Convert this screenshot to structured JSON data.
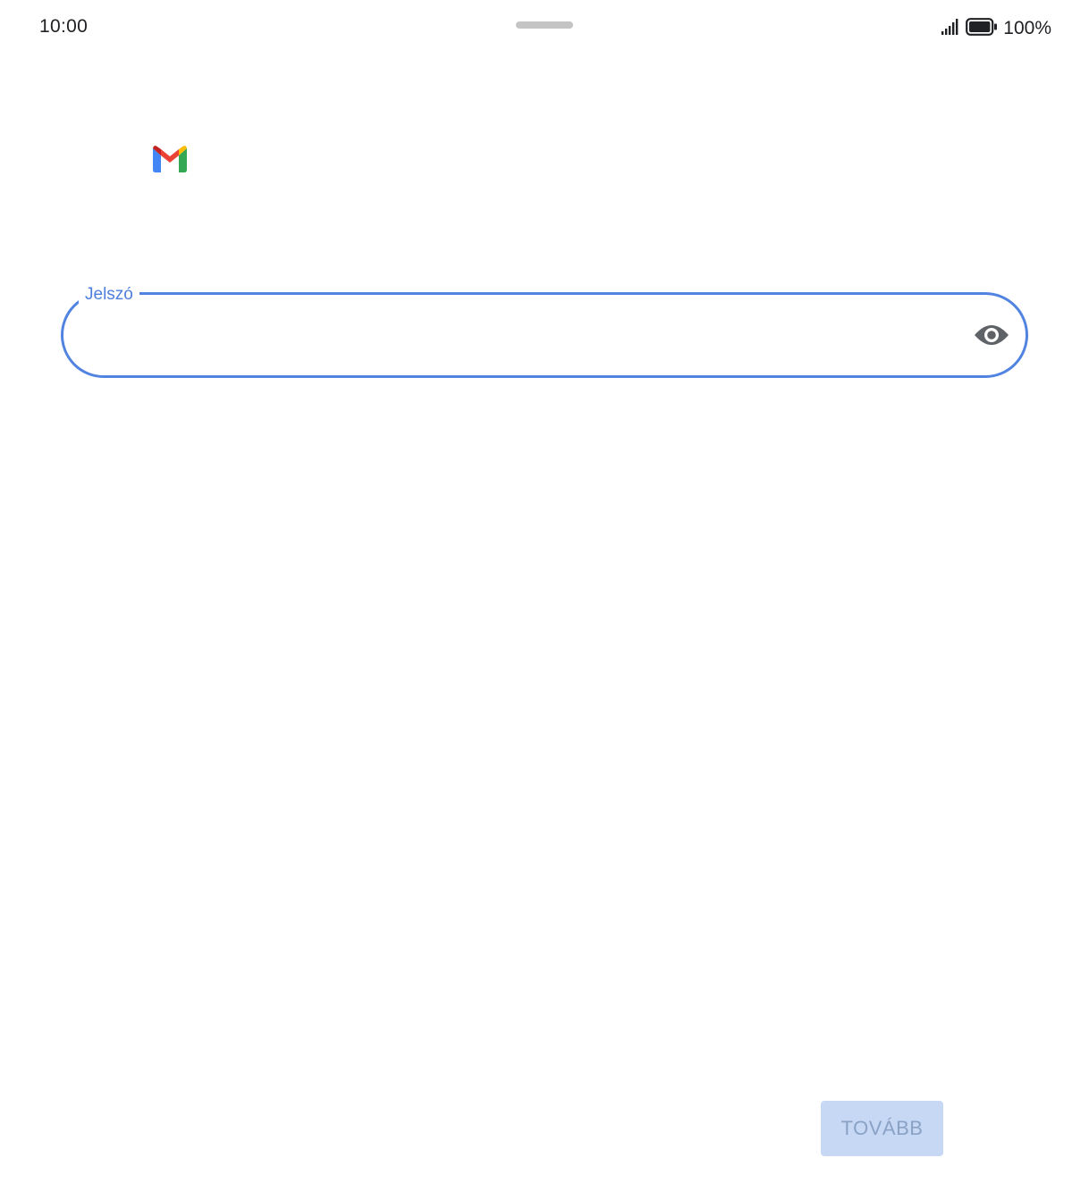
{
  "status_bar": {
    "time": "10:00",
    "battery_percent": "100%",
    "signal_icon": "signal-icon",
    "battery_icon": "battery-icon"
  },
  "logo": {
    "icon": "gmail-logo",
    "colors": {
      "red": "#EA4335",
      "blue": "#4285F4",
      "green": "#34A853",
      "yellow": "#FBBC04",
      "dark_red": "#C5221F"
    }
  },
  "password_field": {
    "label": "Jelszó",
    "value": "",
    "toggle_icon": "eye-icon",
    "accent_color": "#5183E0"
  },
  "next_button": {
    "label": "TOVÁBB",
    "enabled": false
  }
}
